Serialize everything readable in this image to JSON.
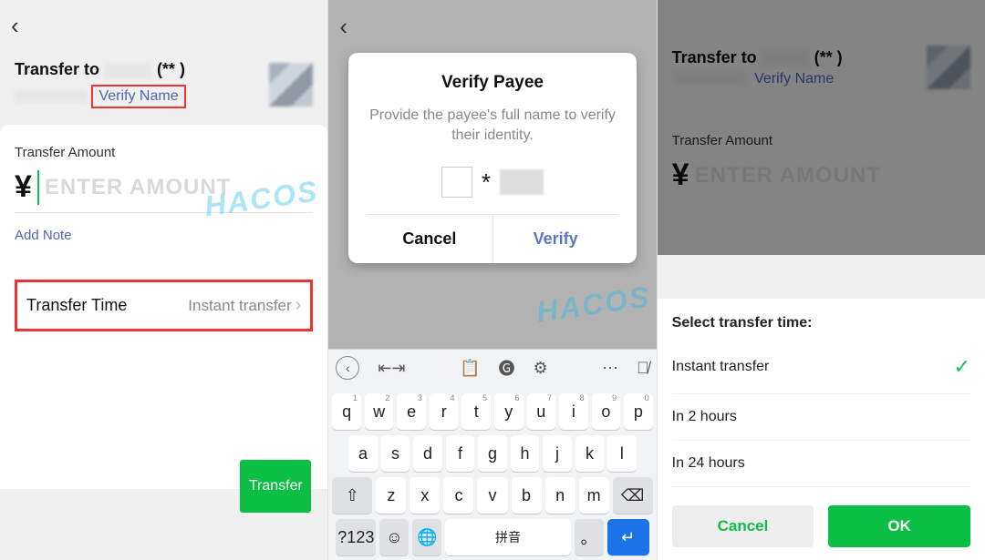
{
  "panel1": {
    "transfer_to_label": "Transfer to",
    "payee_mask": "(**   )",
    "verify_name": "Verify Name",
    "amount_label": "Transfer Amount",
    "currency_symbol": "¥",
    "amount_placeholder": "ENTER AMOUNT",
    "add_note": "Add Note",
    "transfer_time_label": "Transfer Time",
    "transfer_time_value": "Instant transfer",
    "transfer_button": "Transfer"
  },
  "panel2": {
    "modal_title": "Verify Payee",
    "modal_desc": "Provide the payee's full name to verify their identity.",
    "masked_char": "*",
    "cancel": "Cancel",
    "verify": "Verify",
    "keyboard": {
      "row1": [
        "q",
        "w",
        "e",
        "r",
        "t",
        "y",
        "u",
        "i",
        "o",
        "p"
      ],
      "row1_sup": [
        "1",
        "2",
        "3",
        "4",
        "5",
        "6",
        "7",
        "8",
        "9",
        "0"
      ],
      "row2": [
        "a",
        "s",
        "d",
        "f",
        "g",
        "h",
        "j",
        "k",
        "l"
      ],
      "row3": [
        "z",
        "x",
        "c",
        "v",
        "b",
        "n",
        "m"
      ],
      "shift": "⇧",
      "backspace": "⌫",
      "numeric": "?123",
      "emoji": "☺",
      "globe": "🌐",
      "space_label": "拼音",
      "period": "。",
      "enter": "↵"
    }
  },
  "panel3": {
    "transfer_to_label": "Transfer to",
    "payee_mask": "(**   )",
    "verify_name": "Verify Name",
    "amount_label": "Transfer Amount",
    "currency_symbol": "¥",
    "amount_placeholder": "ENTER AMOUNT",
    "sheet_title": "Select transfer time:",
    "options": [
      "Instant transfer",
      "In 2 hours",
      "In 24 hours"
    ],
    "selected_index": 0,
    "cancel": "Cancel",
    "ok": "OK"
  },
  "watermark": "HACOS"
}
